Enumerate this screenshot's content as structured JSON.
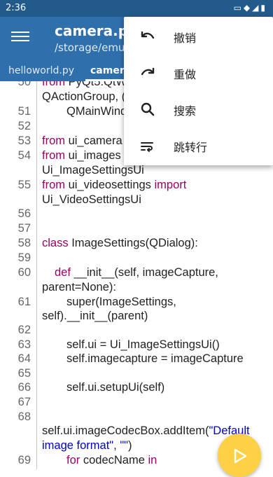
{
  "status_bar": {
    "time": "2:36",
    "icons": [
      "notification-icon",
      "wifi-icon",
      "signal-icon",
      "battery-icon"
    ]
  },
  "appbar": {
    "title": "camera.py",
    "subtitle": "/storage/emu"
  },
  "tabs": [
    {
      "label": "helloworld.py"
    },
    {
      "label": "camera"
    }
  ],
  "menu": {
    "items": [
      {
        "label": "撤销",
        "icon": "undo-icon"
      },
      {
        "label": "重做",
        "icon": "redo-icon"
      },
      {
        "label": "搜索",
        "icon": "search-icon"
      },
      {
        "label": "跳转行",
        "icon": "goto-line-icon"
      }
    ]
  },
  "editor": {
    "lines": [
      {
        "num": "50",
        "text": "from PyQt5.QtW"
      },
      {
        "num": "",
        "text": "QActionGroup, ("
      },
      {
        "num": "51",
        "text": "QMainWind"
      },
      {
        "num": "52",
        "text": ""
      },
      {
        "num": "53",
        "text": "from ui_camera"
      },
      {
        "num": "54",
        "text": "from ui_images"
      },
      {
        "num": "",
        "text": "Ui_ImageSettingsUi"
      },
      {
        "num": "55",
        "text": "from ui_videosettings import"
      },
      {
        "num": "",
        "text": "Ui_VideoSettingsUi"
      },
      {
        "num": "56",
        "text": ""
      },
      {
        "num": "57",
        "text": ""
      },
      {
        "num": "58",
        "text": "class ImageSettings(QDialog):"
      },
      {
        "num": "59",
        "text": ""
      },
      {
        "num": "60",
        "text": "def __init__(self, imageCapture,"
      },
      {
        "num": "",
        "text": "parent=None):"
      },
      {
        "num": "61",
        "text": "super(ImageSettings,"
      },
      {
        "num": "",
        "text": "self).__init__(parent)"
      },
      {
        "num": "62",
        "text": ""
      },
      {
        "num": "63",
        "text": "self.ui = Ui_ImageSettingsUi()"
      },
      {
        "num": "64",
        "text": "self.imagecapture = imageCapture"
      },
      {
        "num": "65",
        "text": ""
      },
      {
        "num": "66",
        "text": "self.ui.setupUi(self)"
      },
      {
        "num": "67",
        "text": ""
      },
      {
        "num": "68",
        "text": ""
      },
      {
        "num": "",
        "text": "self.ui.imageCodecBox.addItem(\"Default"
      },
      {
        "num": "",
        "text": "image format\", \"\")"
      },
      {
        "num": "69",
        "text": "for codecName in"
      }
    ]
  },
  "fab": {
    "icon": "run-icon"
  },
  "colors": {
    "appbar": "#2f6fab",
    "statusbar": "#235a8c",
    "fab": "#fdd046",
    "keyword": "#990066",
    "string": "#0000cc"
  }
}
